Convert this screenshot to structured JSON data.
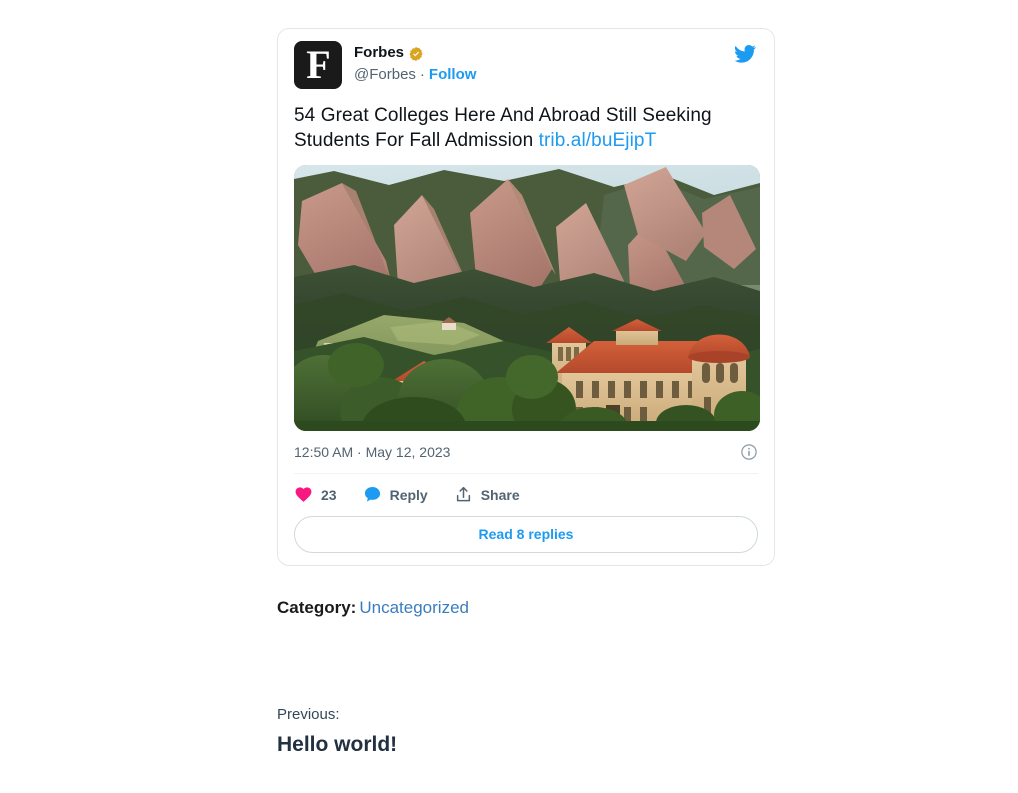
{
  "tweet": {
    "avatar_letter": "F",
    "display_name": "Forbes",
    "verified_icon": "verified-badge-gold",
    "handle": "@Forbes",
    "separator": "·",
    "follow_label": "Follow",
    "brand_icon": "twitter-bird-icon",
    "text": "54 Great Colleges Here And Abroad Still Seeking Students For Fall Admission ",
    "link_text": "trib.al/buEjipT",
    "photo_alt": "Flatirons rock formation above University of Colorado Boulder campus buildings with red tile roofs",
    "timestamp": "12:50 AM · May 12, 2023",
    "info_icon": "info-circle-icon",
    "actions": {
      "like": {
        "icon": "heart-icon",
        "count": "23"
      },
      "reply": {
        "icon": "reply-bubble-icon",
        "label": "Reply"
      },
      "share": {
        "icon": "share-upload-icon",
        "label": "Share"
      }
    },
    "read_replies_label": "Read 8 replies"
  },
  "footer": {
    "category_label": "Category:",
    "category_value": "Uncategorized",
    "previous_label": "Previous:",
    "previous_title": "Hello world!"
  },
  "colors": {
    "twitter_blue": "#1d9bf0",
    "like_pink": "#f91880",
    "verified_gold": "#d9a521",
    "text_primary": "#0f1419",
    "text_secondary": "#536471",
    "card_border": "#e1e8ed",
    "link_blue": "#3a7dbf"
  }
}
